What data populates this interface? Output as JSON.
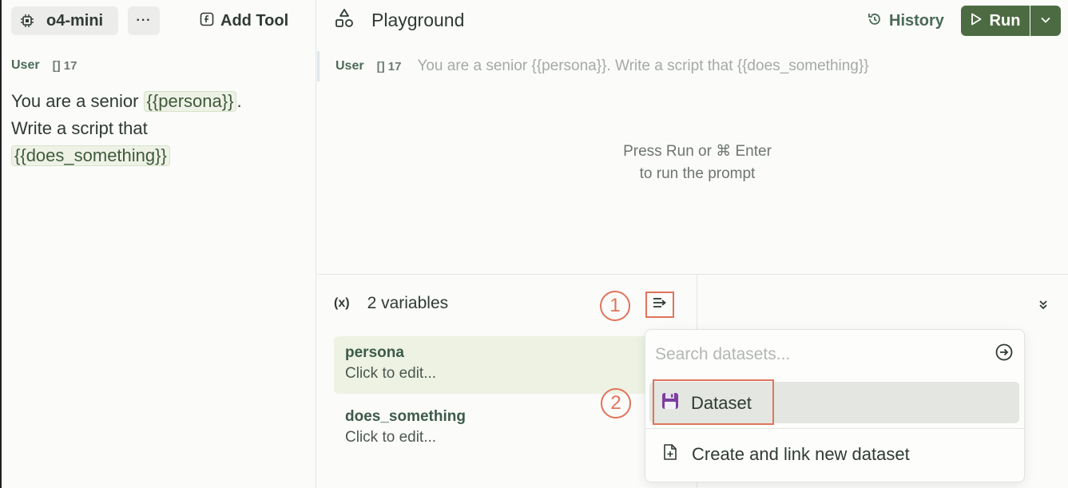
{
  "left": {
    "model": "o4-mini",
    "more": "···",
    "add_tool": "Add Tool",
    "role": "User",
    "token_bracket": "[]",
    "token_count": "17",
    "prompt": {
      "t1": "You are a senior ",
      "var1": "{{persona}}",
      "t2": ".",
      "t3": "Write a script that",
      "var2": "{{does_something}}"
    }
  },
  "header": {
    "title": "Playground",
    "history": "History",
    "run": "Run"
  },
  "message": {
    "role": "User",
    "token_bracket": "[]",
    "token_count": "17",
    "preview": "You are a senior {{persona}}. Write a script that {{does_something}}"
  },
  "hint": {
    "line1": "Press Run or ⌘ Enter",
    "line2": "to run the prompt"
  },
  "variables": {
    "icon_text": "(x)",
    "count_label": "2 variables",
    "items": [
      {
        "name": "persona",
        "value": "Click to edit..."
      },
      {
        "name": "does_something",
        "value": "Click to edit..."
      }
    ]
  },
  "annotations": {
    "step1": "1",
    "step2": "2"
  },
  "dataset_menu": {
    "search_placeholder": "Search datasets...",
    "items": [
      {
        "label": "Dataset"
      },
      {
        "label": "Create and link new dataset"
      }
    ]
  },
  "colors": {
    "accent": "#4d6b43",
    "annotation": "#e0745a",
    "chip_bg": "#eef2e6"
  }
}
